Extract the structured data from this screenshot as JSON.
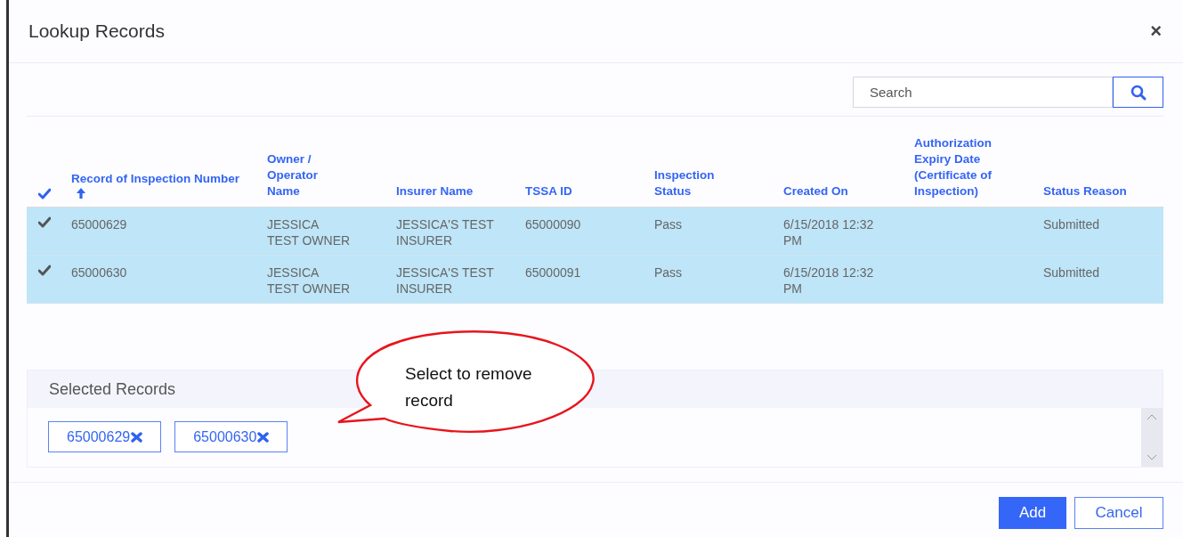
{
  "dialog": {
    "title": "Lookup Records",
    "close": "×"
  },
  "search": {
    "placeholder": "Search"
  },
  "table": {
    "select_all": {
      "checked": true
    },
    "columns": [
      {
        "label": "Record of Inspection Number",
        "sorted_ascending": true
      },
      {
        "label": "Owner / Operator Name",
        "sorted_ascending": false
      },
      {
        "label": "Insurer Name",
        "sorted_ascending": false
      },
      {
        "label": "TSSA ID",
        "sorted_ascending": false
      },
      {
        "label": "Inspection Status",
        "sorted_ascending": false
      },
      {
        "label": "Created On",
        "sorted_ascending": false
      },
      {
        "label": "Authorization Expiry Date (Certificate of Inspection)",
        "sorted_ascending": false
      },
      {
        "label": "Status Reason",
        "sorted_ascending": false
      }
    ],
    "rows": [
      {
        "selected": true,
        "cells": [
          "65000629",
          "JESSICA TEST OWNER",
          "JESSICA'S TEST INSURER",
          "65000090",
          "Pass",
          "6/15/2018 12:32 PM",
          "",
          "Submitted"
        ]
      },
      {
        "selected": true,
        "cells": [
          "65000630",
          "JESSICA TEST OWNER",
          "JESSICA'S TEST INSURER",
          "65000091",
          "Pass",
          "6/15/2018 12:32 PM",
          "",
          "Submitted"
        ]
      }
    ]
  },
  "selected_records": {
    "title": "Selected Records",
    "chips": [
      {
        "label": "65000629"
      },
      {
        "label": "65000630"
      }
    ]
  },
  "callout": {
    "text": "Select to remove record"
  },
  "buttons": [
    {
      "label": "Add",
      "kind": "primary"
    },
    {
      "label": "Cancel",
      "kind": "secondary"
    }
  ]
}
